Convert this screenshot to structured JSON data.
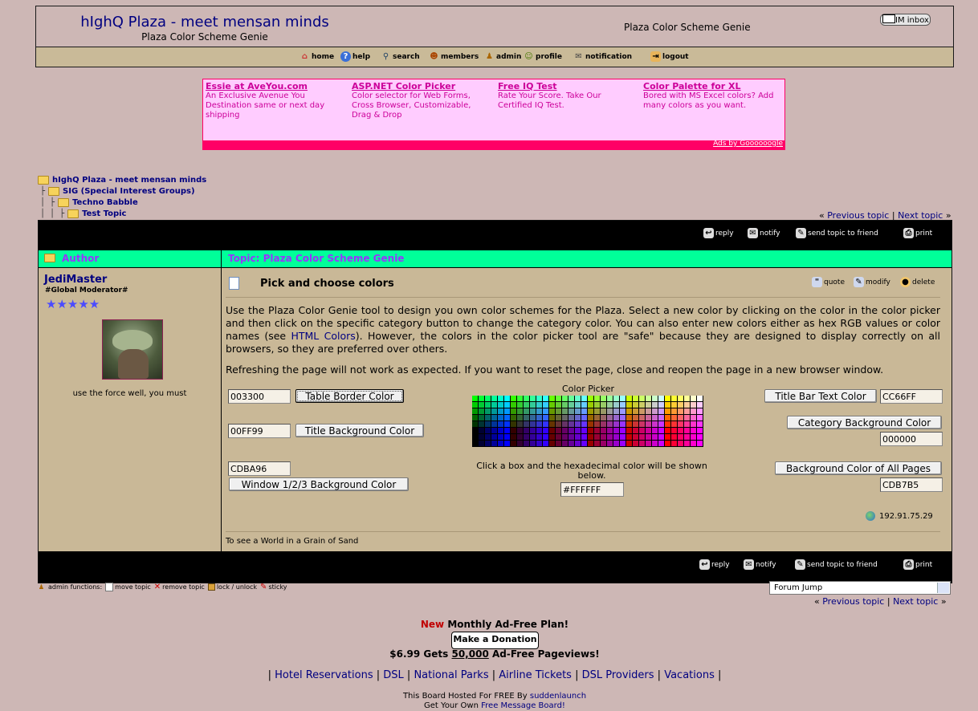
{
  "header": {
    "site_title": "hIghQ Plaza - meet mensan minds",
    "subtitle": "Plaza Color Scheme Genie",
    "page_title_right": "Plaza Color Scheme Genie",
    "im_inbox": "IM inbox"
  },
  "nav": {
    "items": [
      {
        "label": "home",
        "icon": "home-icon"
      },
      {
        "label": "help",
        "icon": "help-icon"
      },
      {
        "label": "search",
        "icon": "search-icon"
      },
      {
        "label": "members",
        "icon": "members-icon"
      },
      {
        "label": "admin",
        "icon": "admin-icon"
      },
      {
        "label": "profile",
        "icon": "profile-icon"
      },
      {
        "label": "notification",
        "icon": "notification-icon"
      },
      {
        "label": "logout",
        "icon": "logout-icon"
      }
    ]
  },
  "ads": {
    "items": [
      {
        "title": "Essie at AveYou.com",
        "text": "An Exclusive Avenue You Destination same or next day shipping"
      },
      {
        "title": "ASP.NET Color Picker",
        "text": "Color selector for Web Forms, Cross Browser, Customizable, Drag & Drop"
      },
      {
        "title": "Free IQ Test",
        "text": "Rate Your Score. Take Our Certified IQ Test."
      },
      {
        "title": "Color Palette for XL",
        "text": "Bored with MS Excel colors? Add many colors as you want."
      }
    ],
    "ads_by": "Ads by Goooooogle"
  },
  "breadcrumb": {
    "items": [
      "hIghQ Plaza - meet mensan minds",
      "SIG (Special Interest Groups)",
      "Techno Babble",
      "Test Topic"
    ]
  },
  "topic_nav": {
    "prev_open": "«",
    "prev": "Previous topic",
    "sep": "|",
    "next": "Next topic",
    "next_close": "»"
  },
  "actions": {
    "reply": "reply",
    "notify": "notify",
    "send": "send topic to friend",
    "print": "print"
  },
  "table": {
    "author_header": "Author",
    "topic_header": "Topic: Plaza Color Scheme Genie"
  },
  "author": {
    "name": "JediMaster",
    "role": "#Global Moderator#",
    "stars": "★★★★★",
    "signature_tag": "use the force well, you must"
  },
  "post": {
    "title": "Pick and choose colors",
    "quote": "quote",
    "modify": "modify",
    "delete": "delete",
    "body_1a": "Use the Plaza Color Genie tool to design you own color schemes for the Plaza. Select a new color by clicking on the color in the color picker and then click on the specific category button to change the category color. You can also enter new colors either as hex RGB values or color names (see ",
    "body_1_link": "HTML Colors",
    "body_1b": "). However, the colors in the color picker tool are \"safe\" because they are designed to display correctly on all browsers, so they are preferred over others.",
    "body_2": "Refreshing the page will not work as expected. If you want to reset the page, close and reopen the page in a new browser window.",
    "ip": "192.91.75.29",
    "signature": "To see a World in a Grain of Sand"
  },
  "color_tool": {
    "table_border_value": "003300",
    "table_border_label": "Table Border Color",
    "title_bg_value": "00FF99",
    "title_bg_label": "Title Background Color",
    "window_bg_value": "CDBA96",
    "window_bg_label": "Window 1/2/3 Background Color",
    "picker_title": "Color Picker",
    "picker_hint": "Click a box and the hexadecimal color will be shown below.",
    "picker_value": "#FFFFFF",
    "title_text_label": "Title Bar Text Color",
    "title_text_value": "CC66FF",
    "category_bg_label": "Category Background Color",
    "category_bg_value": "000000",
    "page_bg_label": "Background Color of All Pages",
    "page_bg_value": "CDB7B5"
  },
  "admin": {
    "functions": "admin functions:",
    "move": "move topic",
    "remove": "remove topic",
    "lock": "lock / unlock",
    "sticky": "sticky"
  },
  "forum_jump": "Forum Jump",
  "footer": {
    "new": "New",
    "plan": "Monthly Ad-Free Plan!",
    "donate": "Make a Donation",
    "price_a": "$6.99 Gets",
    "price_b": "50,000",
    "price_c": "Ad-Free Pageviews!",
    "links": [
      "Hotel Reservations",
      "DSL",
      "National Parks",
      "Airline Tickets",
      "DSL Providers",
      "Vacations"
    ],
    "hosted": "This Board Hosted For FREE By",
    "hosted_link": "suddenlaunch",
    "get_own": "Get Your Own",
    "get_own_link": "Free Message Board!"
  },
  "colors": {
    "page_bg": "#CDB7B5",
    "window_bg": "#CDBA96",
    "title_bg": "#00FF99",
    "title_text": "#CC66FF"
  }
}
